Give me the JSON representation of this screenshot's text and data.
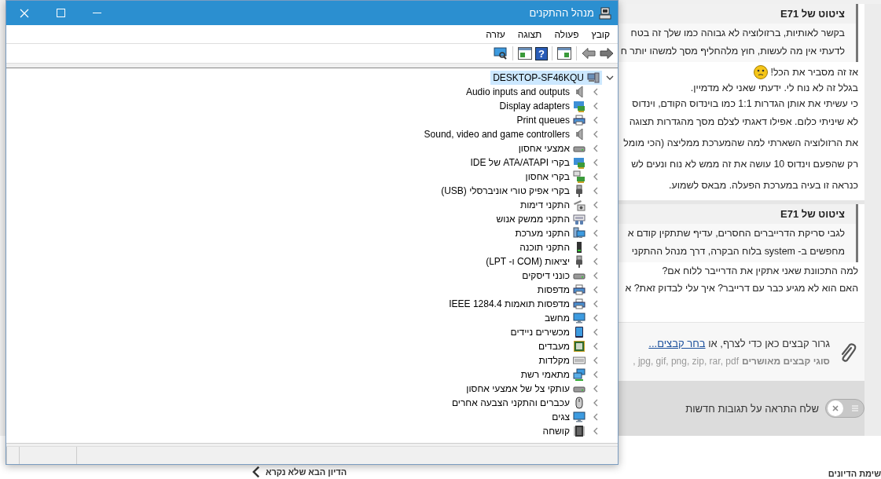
{
  "window": {
    "title": "מנהל ההתקנים"
  },
  "menu": [
    {
      "label": "קובץ"
    },
    {
      "label": "פעולה"
    },
    {
      "label": "תצוגה"
    },
    {
      "label": "עזרה"
    }
  ],
  "toolbar": {
    "help_glyph": "?"
  },
  "tree": {
    "label": "DESKTOP-SF46KQU",
    "kind": "computer",
    "selected": true,
    "expanded": true,
    "children": [
      {
        "label": "Audio inputs and outputs",
        "kind": "speaker",
        "selected": false,
        "expanded": false
      },
      {
        "label": "Display adapters",
        "kind": "adapter",
        "selected": false,
        "expanded": false
      },
      {
        "label": "Print queues",
        "kind": "printer",
        "selected": false,
        "expanded": false
      },
      {
        "label": "Sound, video and game controllers",
        "kind": "speaker",
        "selected": false,
        "expanded": false
      },
      {
        "label": "אמצעי אחסון",
        "kind": "drive",
        "selected": false,
        "expanded": false
      },
      {
        "label": "בקרי ATA/ATAPI של IDE",
        "kind": "adapter",
        "selected": false,
        "expanded": false
      },
      {
        "label": "בקרי אחסון",
        "kind": "storage",
        "selected": false,
        "expanded": false
      },
      {
        "label": "בקרי אפיק טורי אוניברסלי (USB)",
        "kind": "plug",
        "selected": false,
        "expanded": false
      },
      {
        "label": "התקני דימות",
        "kind": "camera",
        "selected": false,
        "expanded": false
      },
      {
        "label": "התקני ממשק אנוש",
        "kind": "hid",
        "selected": false,
        "expanded": false
      },
      {
        "label": "התקני מערכת",
        "kind": "system",
        "selected": false,
        "expanded": false
      },
      {
        "label": "התקני תוכנה",
        "kind": "device",
        "selected": false,
        "expanded": false
      },
      {
        "label": "יציאות (COM ו- LPT)",
        "kind": "plug",
        "selected": false,
        "expanded": false
      },
      {
        "label": "כונני דיסקים",
        "kind": "drive",
        "selected": false,
        "expanded": false
      },
      {
        "label": "מדפסות",
        "kind": "printer",
        "selected": false,
        "expanded": false
      },
      {
        "label": "מדפסות תואמות IEEE 1284.4",
        "kind": "printer",
        "selected": false,
        "expanded": false
      },
      {
        "label": "מחשב",
        "kind": "monitor",
        "selected": false,
        "expanded": false
      },
      {
        "label": "מכשירים ניידים",
        "kind": "tablet",
        "selected": false,
        "expanded": false
      },
      {
        "label": "מעבדים",
        "kind": "processor",
        "selected": false,
        "expanded": false
      },
      {
        "label": "מקלדות",
        "kind": "keyboard",
        "selected": false,
        "expanded": false
      },
      {
        "label": "מתאמי רשת",
        "kind": "network",
        "selected": false,
        "expanded": false
      },
      {
        "label": "עותקי צל של אמצעי אחסון",
        "kind": "drive",
        "selected": false,
        "expanded": false
      },
      {
        "label": "עכברים והתקני הצבעה אחרים",
        "kind": "mouse",
        "selected": false,
        "expanded": false
      },
      {
        "label": "צגים",
        "kind": "monitor",
        "selected": false,
        "expanded": false
      },
      {
        "label": "קושחה",
        "kind": "chip",
        "selected": false,
        "expanded": false
      }
    ]
  },
  "posts": [
    {
      "quote": {
        "header": "ציטוט של E71",
        "lines": [
          "בקשר לאותיות, ברזולוציה לא גבוהה כמו שלך זה בטח",
          "לדעתי אין מה לעשות, חוץ מלהחליף מסך למשהו יותר ח"
        ]
      },
      "lines": [
        {
          "text": "אז זה מסביר את הכל!",
          "emoji": true
        },
        {
          "text": "בגלל זה לא נוח לי. ידעתי שאני לא מדמיין.",
          "emoji": false
        },
        {
          "text": "כי עשיתי את אותן הגדרות 1:1 כמו בוינדוס הקודם, וינדוס",
          "emoji": false
        },
        {
          "text": "לא שיניתי כלום. אפילו דאגתי לצלם מסך מהגדרות תצוגה",
          "emoji": false
        },
        {
          "text": "את הרזולוציה השארתי למה שהמערכת ממליצה (הכי מומל",
          "emoji": false
        },
        {
          "text": "רק שהפעם וינדוס 10 עושה את זה ממש לא נוח ונעים לש",
          "emoji": false
        },
        {
          "text": "כנראה זו בעיה במערכת הפעלה. מבאס לשמוע.",
          "emoji": false
        }
      ]
    },
    {
      "quote": {
        "header": "ציטוט של E71",
        "lines": [
          "לגבי סריקת הדרייברים החסרים, עדיף שתתקין קודם א",
          "מחפשים ב- system בלוח הבקרה, דרך מנהל ההתקני"
        ]
      },
      "lines": [
        {
          "text": "למה התכוונת שאני אתקין את הדרייבר ללוח אם?",
          "emoji": false
        },
        {
          "text": "האם הוא לא מגיע כבר עם דרייבר? איך עלי לבדוק זאת? א",
          "emoji": false
        }
      ]
    }
  ],
  "attachments": {
    "prompt": "גרור קבצים כאן כדי לצרף, או",
    "link": "בחר קבצים...",
    "types_label": "סוגי קבצים מאושרים",
    "types": ", jpg, gif, png, zip, rar, pdf"
  },
  "notify": {
    "label": "שלח התראה על תגובות חדשות",
    "on": false
  },
  "footer": {
    "next": "הדיון הבא שלא נקרא",
    "list": "שימת הדיונים"
  }
}
